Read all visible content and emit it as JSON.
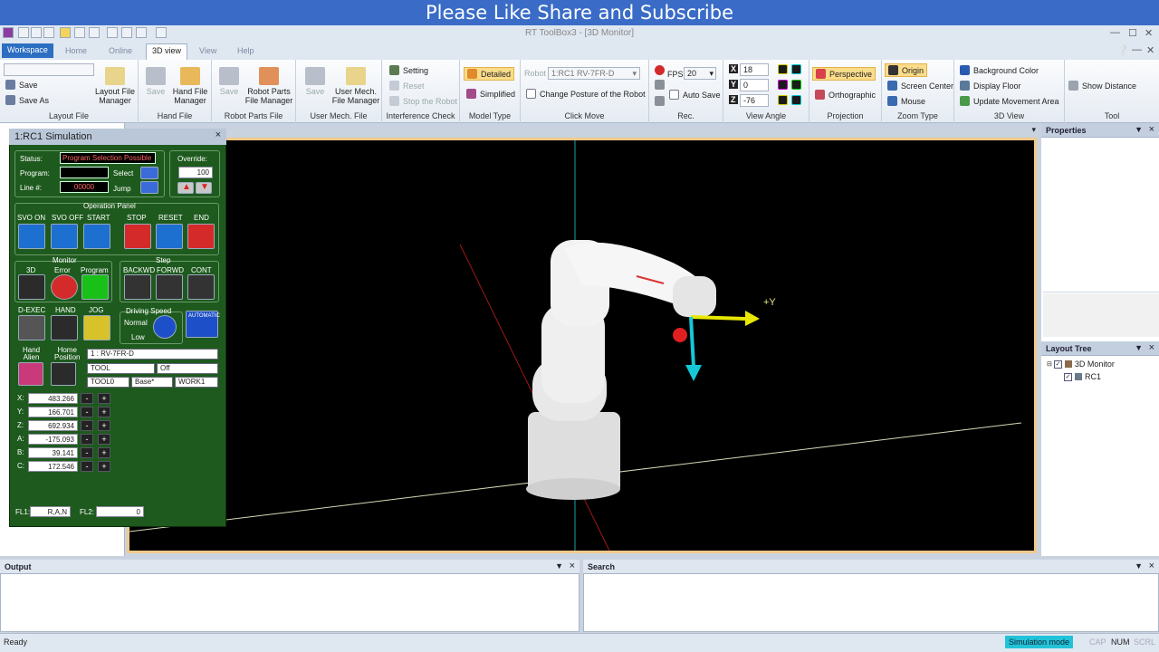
{
  "banner": "Please Like Share and Subscribe",
  "window": {
    "title": "RT ToolBox3 - [3D Monitor]"
  },
  "menu": {
    "workspace": "Workspace",
    "tabs": [
      "Home",
      "Online",
      "3D view",
      "View",
      "Help"
    ]
  },
  "quick": {
    "save": "Save",
    "save_as": "Save As"
  },
  "ribbon": {
    "layout_file": {
      "label": "Layout File",
      "manager": "Layout File\nManager"
    },
    "hand_file": {
      "label": "Hand File",
      "save": "Save",
      "manager": "Hand File\nManager"
    },
    "robot_parts": {
      "label": "Robot Parts File",
      "save": "Save",
      "manager": "Robot Parts\nFile Manager"
    },
    "user_mech": {
      "label": "User Mech. File",
      "save": "Save",
      "manager": "User Mech.\nFile Manager"
    },
    "interference": {
      "label": "Interference Check",
      "setting": "Setting",
      "reset": "Reset",
      "stop": "Stop the Robot"
    },
    "model_type": {
      "label": "Model Type",
      "detailed": "Detailed",
      "simplified": "Simplified"
    },
    "click_move": {
      "label": "Click Move",
      "robot_label": "Robot",
      "robot_value": "1:RC1 RV-7FR-D",
      "change_posture": "Change Posture of the Robot"
    },
    "rec": {
      "label": "Rec.",
      "fps_label": "FPS:",
      "fps_value": "20",
      "auto_save": "Auto Save"
    },
    "view_angle": {
      "label": "View Angle",
      "x": "18",
      "y": "0",
      "z": "-76"
    },
    "projection": {
      "label": "Projection",
      "perspective": "Perspective",
      "orthographic": "Orthographic"
    },
    "zoom_type": {
      "label": "Zoom Type",
      "origin": "Origin",
      "screen_center": "Screen Center",
      "mouse": "Mouse"
    },
    "view3d": {
      "label": "3D View",
      "background": "Background Color",
      "floor": "Display Floor",
      "movement": "Update Movement Area"
    },
    "tool": {
      "label": "Tool",
      "show_distance": "Show Distance"
    }
  },
  "sim": {
    "title": "1:RC1  Simulation",
    "status_label": "Status:",
    "status_value": "Program Selection Possible",
    "program_label": "Program:",
    "line_label": "Line #:",
    "line_value": "00000",
    "select": "Select",
    "jump": "Jump",
    "override_label": "Override:",
    "override_value": "100",
    "operation_panel": "Operation Panel",
    "ops": [
      "SVO ON",
      "SVO OFF",
      "START",
      "STOP",
      "RESET",
      "END"
    ],
    "monitor": "Monitor",
    "monitor_items": [
      "3D",
      "Error",
      "Program"
    ],
    "step": "Step",
    "step_items": [
      "BACKWD",
      "FORWD",
      "CONT"
    ],
    "exec_items": [
      "D-EXEC",
      "HAND",
      "JOG"
    ],
    "driving_speed": "Driving Speed",
    "normal": "Normal",
    "low": "Low",
    "automatic": "AUTOMATIC",
    "hand_alien": "Hand\nAlien",
    "home_position": "Home\nPosition",
    "robot_combo": "1 : RV-7FR-D",
    "tool_combo": "TOOL",
    "off_combo": "Off",
    "tool0": "TOOL0",
    "base": "Base*",
    "work1": "WORK1",
    "coords": [
      {
        "label": "X:",
        "value": "483.266"
      },
      {
        "label": "Y:",
        "value": "166.701"
      },
      {
        "label": "Z:",
        "value": "692.934"
      },
      {
        "label": "A:",
        "value": "-175.093"
      },
      {
        "label": "B:",
        "value": "39.141"
      },
      {
        "label": "C:",
        "value": "172.546"
      }
    ],
    "fl1_label": "FL1:",
    "fl1_value": "R,A,N",
    "fl2_label": "FL2:",
    "fl2_value": "0"
  },
  "viewport": {
    "axis_label": "+Y"
  },
  "panels": {
    "properties": "Properties",
    "layout_tree": "Layout Tree",
    "tree_root": "3D Monitor",
    "tree_child": "RC1",
    "output": "Output",
    "search": "Search"
  },
  "status": {
    "ready": "Ready",
    "mode": "Simulation mode",
    "cap": "CAP",
    "num": "NUM",
    "scrl": "SCRL"
  },
  "colors": {
    "accent": "#2b6ec2",
    "sim_bg": "#1e5a1e",
    "robot_red": "#e02020"
  }
}
